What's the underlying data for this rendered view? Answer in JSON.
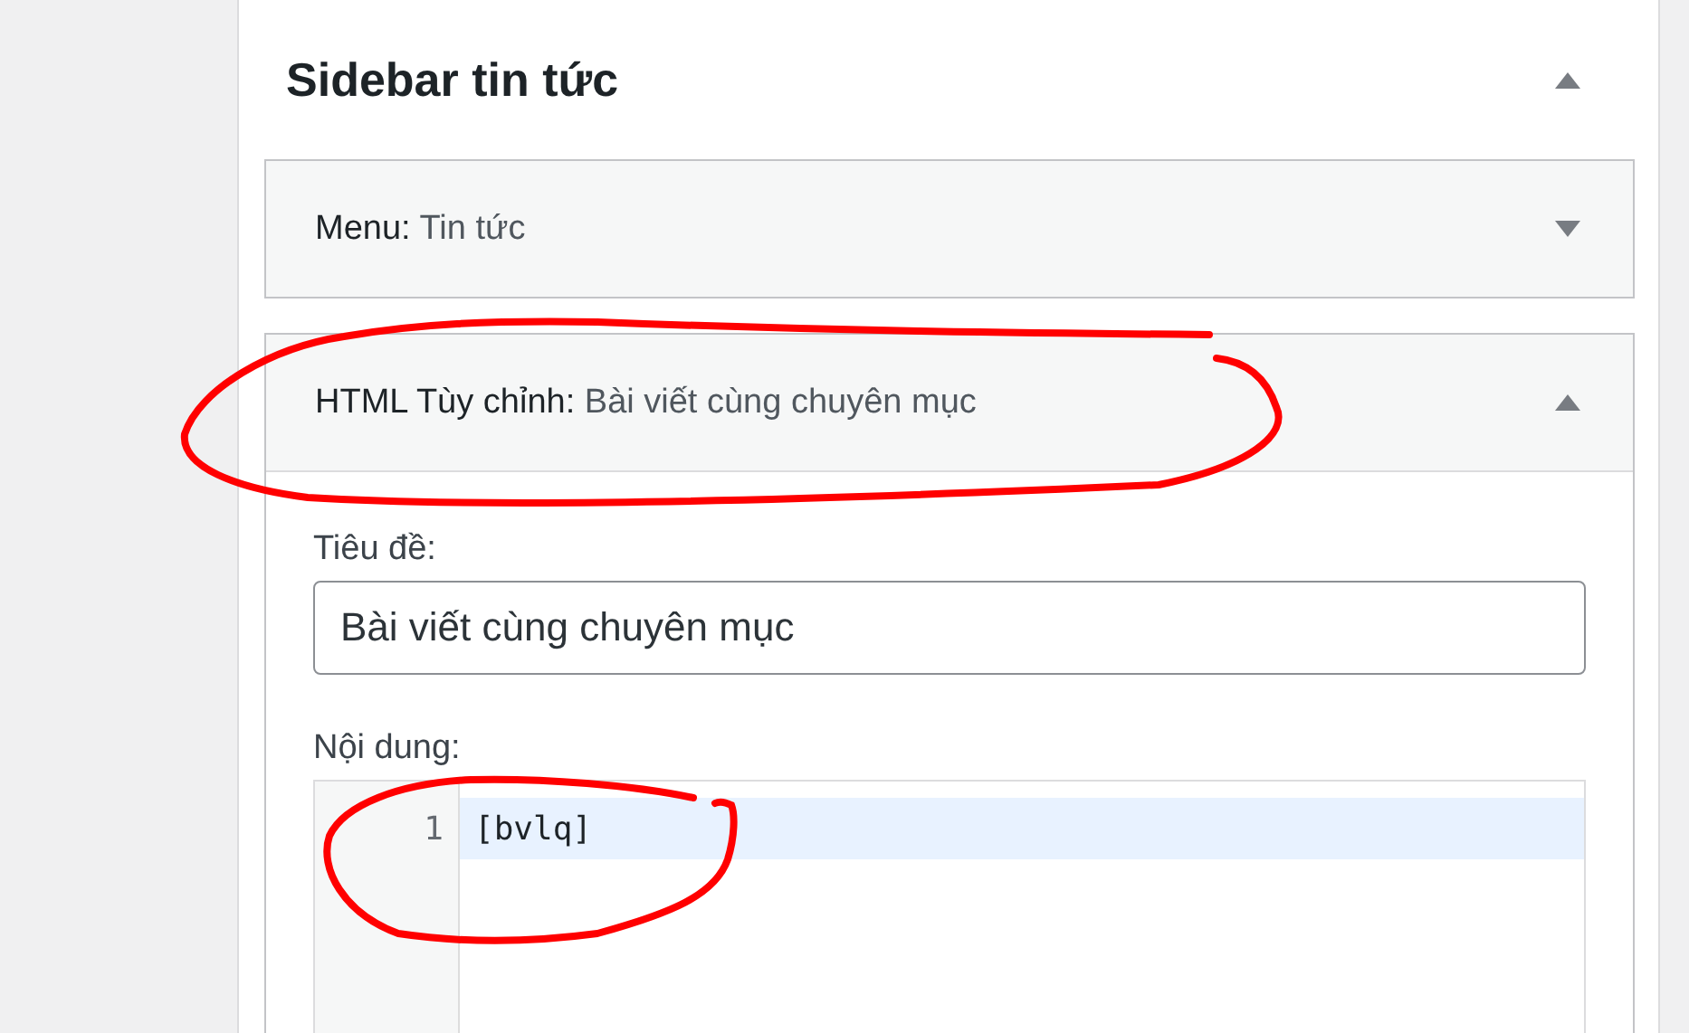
{
  "sidebar": {
    "title": "Sidebar tin tức",
    "expanded": true,
    "widgets": [
      {
        "type": "Menu:",
        "title": "Tin tức",
        "expanded": false
      },
      {
        "type": "HTML Tùy chỉnh:",
        "title": "Bài viết cùng chuyên mục",
        "expanded": true,
        "fields": [
          {
            "label": "Tiêu đề:",
            "kind": "text",
            "value": "Bài viết cùng chuyên mục"
          },
          {
            "label": "Nội dung:",
            "kind": "code",
            "lines": [
              {
                "number": "1",
                "code": "[bvlq]",
                "active": true
              }
            ]
          }
        ]
      }
    ]
  }
}
